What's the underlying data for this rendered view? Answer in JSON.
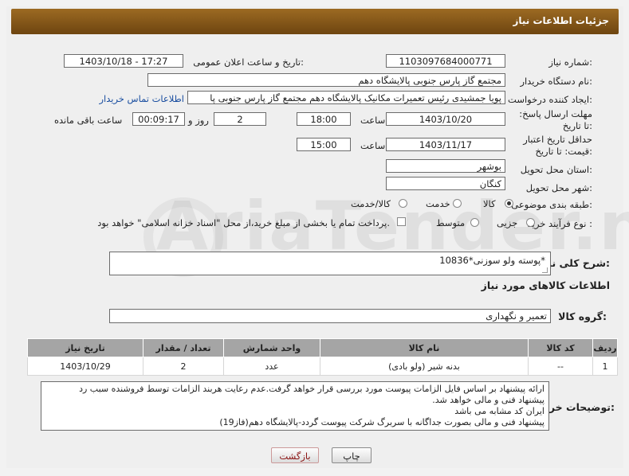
{
  "header_title": "جزئیات اطلاعات نیاز",
  "need_number": {
    "label": "شماره نیاز:",
    "value": "1103097684000771"
  },
  "announce": {
    "label": "تاریخ و ساعت اعلان عمومی:",
    "value": "1403/10/18 - 17:27"
  },
  "buyer_org": {
    "label": "نام دستگاه خریدار:",
    "value": "مجتمع گاز پارس جنوبی  پالایشگاه دهم"
  },
  "requester": {
    "label": "ایجاد کننده درخواست:",
    "value": "پویا جمشیدی رئیس تعمیرات مکانیک پالایشگاه دهم  مجتمع گاز پارس جنوبی  پا",
    "contact_link": "اطلاعات تماس خریدار"
  },
  "reply_deadline": {
    "label": "مهلت ارسال پاسخ: تا تاریخ:",
    "date": "1403/10/20",
    "time_label": "ساعت",
    "time": "18:00",
    "days": "2",
    "days_label": "روز و",
    "remaining": "00:09:17",
    "remaining_label": "ساعت باقی مانده"
  },
  "price_validity": {
    "label": "حداقل تاریخ اعتبار قیمت: تا تاریخ:",
    "date": "1403/11/17",
    "time_label": "ساعت",
    "time": "15:00"
  },
  "province": {
    "label": "استان محل تحویل:",
    "value": "بوشهر"
  },
  "city": {
    "label": "شهر محل تحویل:",
    "value": "کنگان"
  },
  "category": {
    "label": "طبقه بندی موضوعی:",
    "options": [
      "کالا",
      "خدمت",
      "کالا/خدمت"
    ],
    "selected": "کالا"
  },
  "process": {
    "label": "نوع فرآیند خرید :",
    "options": [
      "جزیی",
      "متوسط"
    ],
    "note": "پرداخت تمام یا بخشی از مبلغ خرید،از محل \"اسناد خزانه اسلامی\" خواهد بود."
  },
  "summary": {
    "label": "شرح کلی نیاز:",
    "value": "پوسته ولو سوزنی*10836*"
  },
  "goods_section_title": "اطلاعات کالاهای مورد نیاز",
  "goods_group": {
    "label": "گروه کالا:",
    "value": "تعمیر و نگهداری"
  },
  "table": {
    "headers": [
      "ردیف",
      "کد کالا",
      "نام کالا",
      "واحد شمارش",
      "تعداد / مقدار",
      "تاریخ نیاز"
    ],
    "rows": [
      [
        "1",
        "--",
        "بدنه شیر (ولو بادی)",
        "عدد",
        "2",
        "1403/10/29"
      ]
    ]
  },
  "buyer_notes": {
    "label": "توضیحات خریدار:",
    "lines": [
      "ارائه پیشنهاد بر اساس فایل الزامات پیوست مورد بررسی قرار خواهد گرفت.عدم رعایت هربند الزامات توسط فروشنده سبب رد",
      "پیشنهاد فنی و مالی خواهد شد.",
      "ایران کد مشابه می باشد",
      "پیشنهاد فنی و مالی بصورت جداگانه با سربرگ شرکت پیوست گردد-پالایشگاه دهم(فاز19)"
    ]
  },
  "buttons": {
    "print": "چاپ",
    "back": "بازگشت"
  },
  "watermark": "AriaTender.neT"
}
